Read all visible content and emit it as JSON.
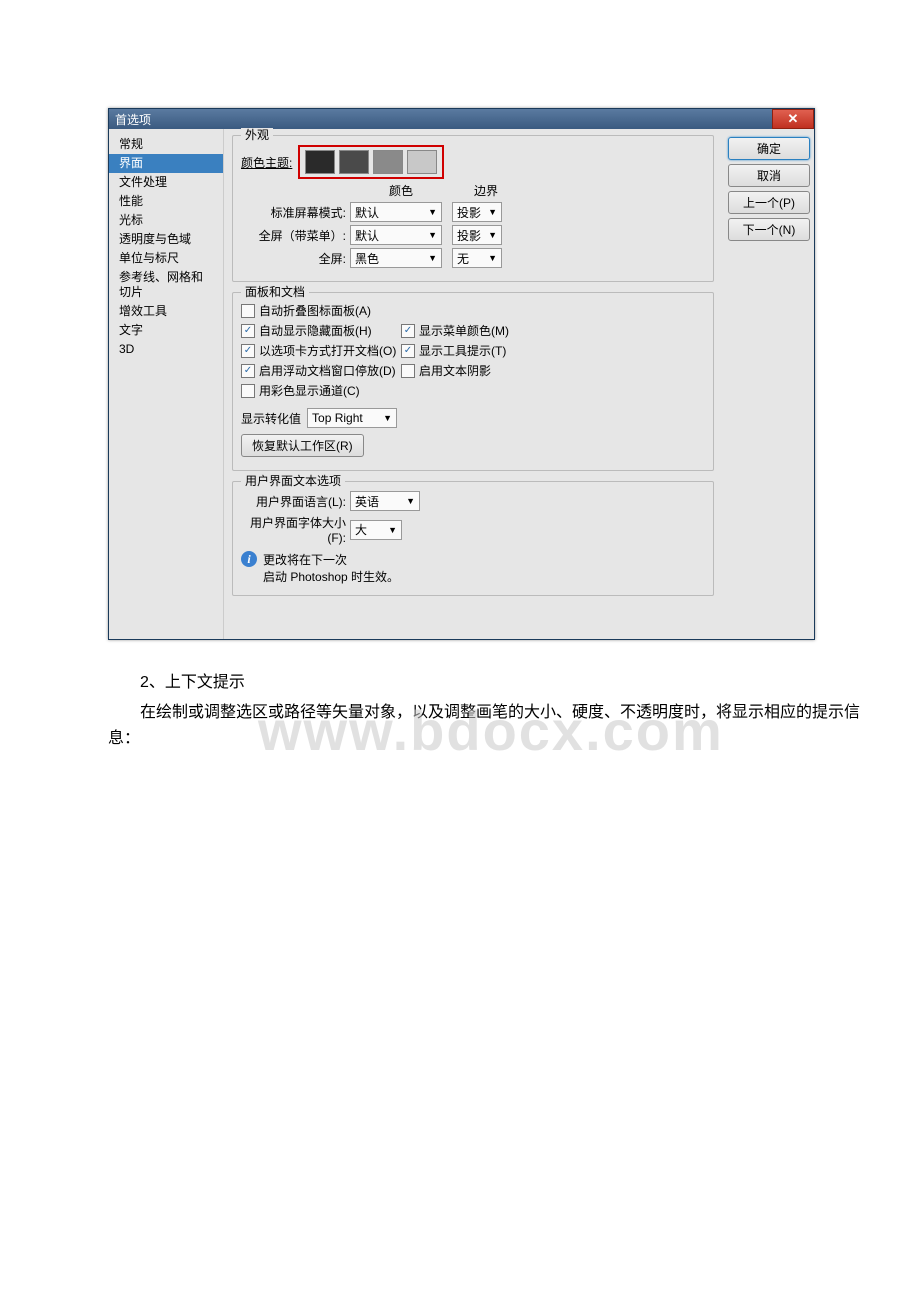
{
  "dialog": {
    "title": "首选项",
    "sidebar": [
      "常规",
      "界面",
      "文件处理",
      "性能",
      "光标",
      "透明度与色域",
      "单位与标尺",
      "参考线、网格和切片",
      "增效工具",
      "文字",
      "3D"
    ],
    "sidebar_active": 1,
    "appearance": {
      "legend": "外观",
      "color_theme_label": "颜色主题:",
      "swatches": [
        "#2a2a2a",
        "#4a4a4a",
        "#8a8a8a",
        "#c8c8c8"
      ],
      "col_color": "颜色",
      "col_border": "边界",
      "rows": [
        {
          "label": "标准屏幕模式:",
          "color": "默认",
          "border": "投影"
        },
        {
          "label": "全屏（带菜单）:",
          "color": "默认",
          "border": "投影"
        },
        {
          "label": "全屏:",
          "color": "黑色",
          "border": "无"
        }
      ]
    },
    "panels": {
      "legend": "面板和文档",
      "auto_collapse": {
        "checked": false,
        "label": "自动折叠图标面板(A)"
      },
      "auto_show_hidden": {
        "checked": true,
        "label": "自动显示隐藏面板(H)"
      },
      "open_as_tabs": {
        "checked": true,
        "label": "以选项卡方式打开文档(O)"
      },
      "floating_dock": {
        "checked": true,
        "label": "启用浮动文档窗口停放(D)"
      },
      "color_channels": {
        "checked": false,
        "label": "用彩色显示通道(C)"
      },
      "show_menu_colors": {
        "checked": true,
        "label": "显示菜单颜色(M)"
      },
      "show_tooltips": {
        "checked": true,
        "label": "显示工具提示(T)"
      },
      "text_shadow": {
        "checked": false,
        "label": "启用文本阴影"
      },
      "show_transform_label": "显示转化值",
      "show_transform_value": "Top Right",
      "reset_workspace": "恢复默认工作区(R)"
    },
    "text_opts": {
      "legend": "用户界面文本选项",
      "lang_label": "用户界面语言(L):",
      "lang_value": "英语",
      "size_label": "用户界面字体大小(F):",
      "size_value": "大",
      "info1": "更改将在下一次",
      "info2": "启动 Photoshop 时生效。"
    },
    "buttons": {
      "ok": "确定",
      "cancel": "取消",
      "prev": "上一个(P)",
      "next": "下一个(N)"
    }
  },
  "article": {
    "p1": "2、上下文提示",
    "p2": "在绘制或调整选区或路径等矢量对象，以及调整画笔的大小、硬度、不透明度时，将显示相应的提示信息："
  },
  "watermark": "www.bdocx.com"
}
